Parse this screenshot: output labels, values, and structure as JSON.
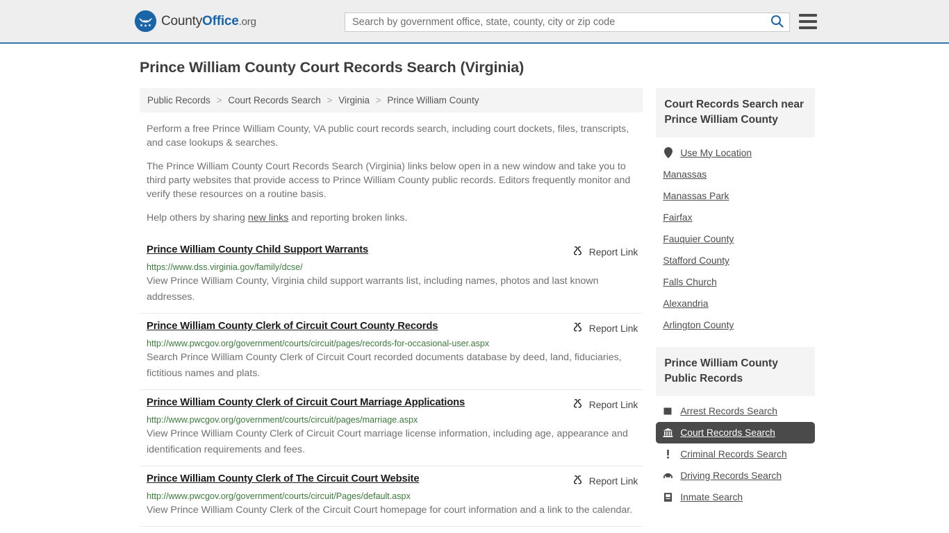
{
  "header": {
    "logo": {
      "part1": "County",
      "part2": "Office",
      "part3": ".org",
      "icon": "eagle-seal-icon"
    },
    "search": {
      "placeholder": "Search by government office, state, county, city or zip code",
      "value": "",
      "button_icon": "search-icon"
    },
    "menu_icon": "hamburger-menu-icon",
    "accent_color": "#3573ac"
  },
  "page": {
    "title": "Prince William County Court Records Search (Virginia)"
  },
  "breadcrumb": {
    "items": [
      "Public Records",
      "Court Records Search",
      "Virginia",
      "Prince William County"
    ],
    "separator": ">"
  },
  "intro": {
    "p1": "Perform a free Prince William County, VA public court records search, including court dockets, files, transcripts, and case lookups & searches.",
    "p2": "The Prince William County Court Records Search (Virginia) links below open in a new window and take you to third party websites that provide access to Prince William County public records. Editors frequently monitor and verify these resources on a routine basis.",
    "p3_before": "Help others by sharing ",
    "p3_link": "new links",
    "p3_after": " and reporting broken links."
  },
  "report_link_label": "Report Link",
  "report_link_icon": "broken-link-icon",
  "results": [
    {
      "title": "Prince William County Child Support Warrants",
      "url": "https://www.dss.virginia.gov/family/dcse/",
      "description": "View Prince William County, Virginia child support warrants list, including names, photos and last known addresses."
    },
    {
      "title": "Prince William County Clerk of Circuit Court County Records",
      "url": "http://www.pwcgov.org/government/courts/circuit/pages/records-for-occasional-user.aspx",
      "description": "Search Prince William County Clerk of Circuit Court recorded documents database by deed, land, fiduciaries, fictitious names and plats."
    },
    {
      "title": "Prince William County Clerk of Circuit Court Marriage Applications",
      "url": "http://www.pwcgov.org/government/courts/circuit/pages/marriage.aspx",
      "description": "View Prince William County Clerk of Circuit Court marriage license information, including age, appearance and identification requirements and fees."
    },
    {
      "title": "Prince William County Clerk of The Circuit Court Website",
      "url": "http://www.pwcgov.org/government/courts/circuit/Pages/default.aspx",
      "description": "View Prince William County Clerk of the Circuit Court homepage for court information and a link to the calendar."
    }
  ],
  "sidebar": {
    "nearby": {
      "heading": "Court Records Search near Prince William County",
      "items": [
        {
          "label": "Use My Location",
          "icon": "map-pin-icon"
        },
        {
          "label": "Manassas",
          "icon": ""
        },
        {
          "label": "Manassas Park",
          "icon": ""
        },
        {
          "label": "Fairfax",
          "icon": ""
        },
        {
          "label": "Fauquier County",
          "icon": ""
        },
        {
          "label": "Stafford County",
          "icon": ""
        },
        {
          "label": "Falls Church",
          "icon": ""
        },
        {
          "label": "Alexandria",
          "icon": ""
        },
        {
          "label": "Arlington County",
          "icon": ""
        }
      ]
    },
    "public_records": {
      "heading": "Prince William County Public Records",
      "items": [
        {
          "label": "Arrest Records Search",
          "icon": "square-icon",
          "active": false
        },
        {
          "label": "Court Records Search",
          "icon": "courthouse-icon",
          "active": true
        },
        {
          "label": "Criminal Records Search",
          "icon": "exclamation-icon",
          "active": false
        },
        {
          "label": "Driving Records Search",
          "icon": "car-icon",
          "active": false
        },
        {
          "label": "Inmate Search",
          "icon": "id-card-icon",
          "active": false
        }
      ]
    },
    "active_color": "#4a4a4a"
  }
}
